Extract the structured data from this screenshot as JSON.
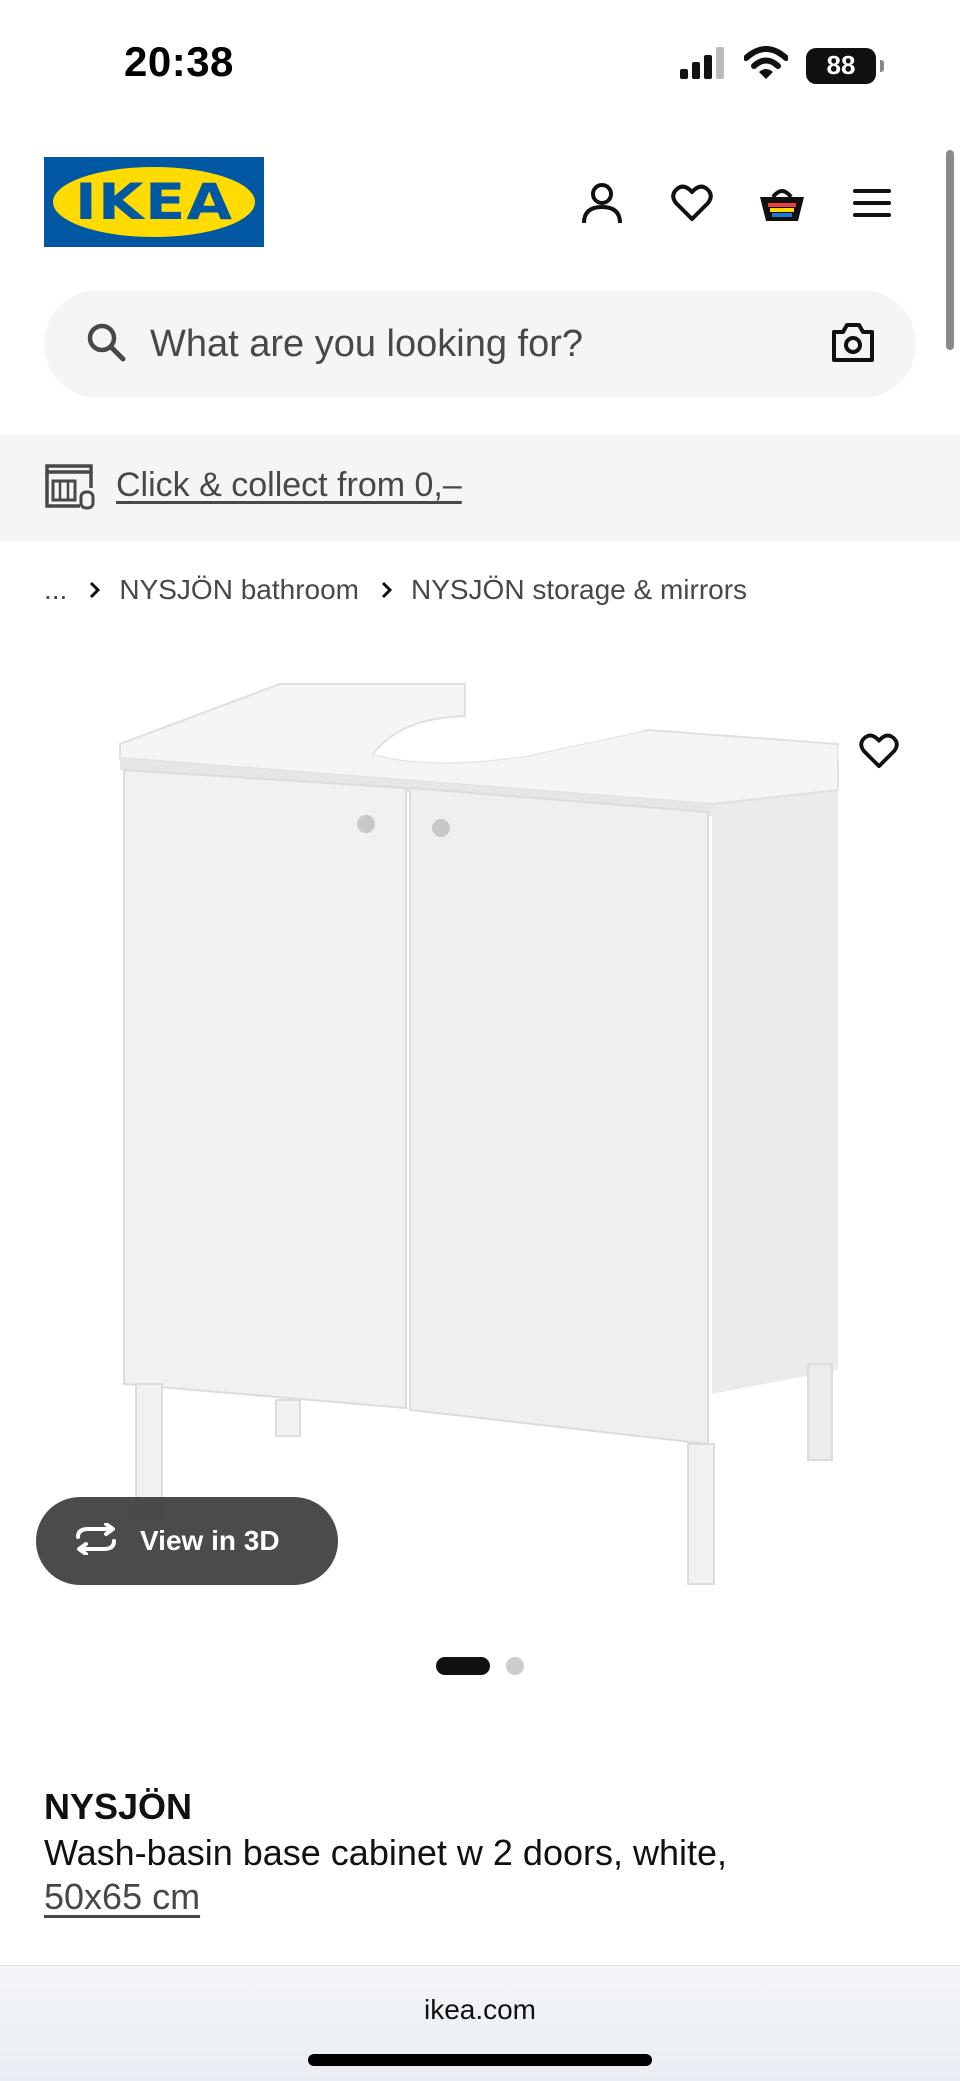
{
  "status_bar": {
    "time": "20:38",
    "battery": "88",
    "icons": [
      "cellular-signal-icon",
      "wifi-icon",
      "battery-icon"
    ]
  },
  "header": {
    "logo_text": "IKEA",
    "icons": [
      "profile-icon",
      "heart-icon",
      "shopping-bag-icon",
      "menu-icon"
    ]
  },
  "search": {
    "placeholder": "What are you looking for?",
    "value": ""
  },
  "banner": {
    "text": "Click & collect from 0,–"
  },
  "breadcrumb": {
    "ellipsis": "...",
    "items": [
      "NYSJÖN bathroom",
      "NYSJÖN storage & mirrors"
    ]
  },
  "gallery": {
    "view3d_label": "View in 3D",
    "slide_count": 2,
    "active_slide": 1
  },
  "product": {
    "name": "NYSJÖN",
    "description": "Wash-basin base cabinet w 2 doors, white,",
    "size": "50x65 cm"
  },
  "browser": {
    "url": "ikea.com"
  },
  "colors": {
    "ikea_blue": "#0058a3",
    "ikea_yellow": "#ffdb00",
    "text_dark": "#111111",
    "text_muted": "#484848",
    "surface_grey": "#f5f5f5"
  }
}
